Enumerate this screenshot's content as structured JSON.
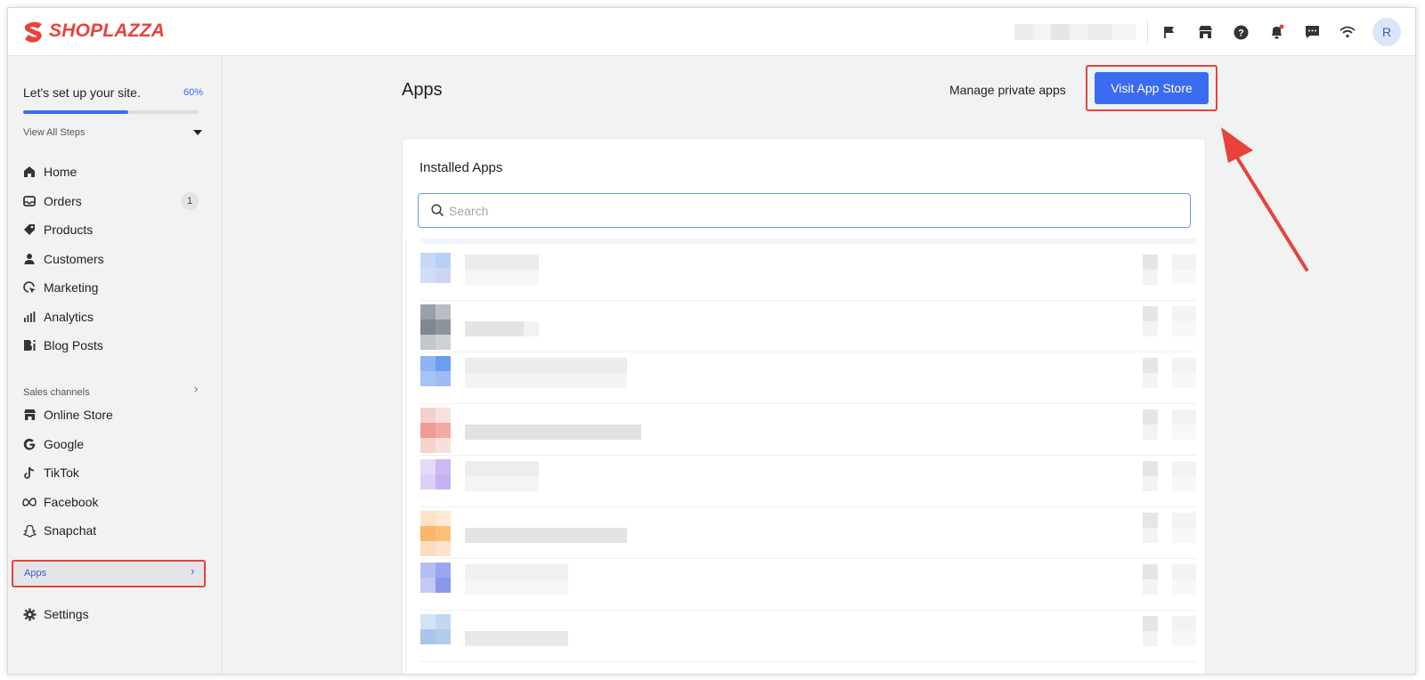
{
  "brand": {
    "name": "SHOPLAZZA",
    "color": "#e8423b"
  },
  "topbar": {
    "icons": [
      "flag-icon",
      "store-icon",
      "help-icon",
      "bell-icon",
      "message-icon",
      "wifi-icon"
    ],
    "avatar_initial": "R"
  },
  "setup": {
    "title": "Let's set up your site.",
    "percent_label": "60%",
    "progress": 0.6,
    "view_steps": "View All Steps"
  },
  "sidebar": {
    "items": [
      {
        "label": "Home",
        "icon": "home-icon"
      },
      {
        "label": "Orders",
        "icon": "inbox-icon",
        "badge": "1"
      },
      {
        "label": "Products",
        "icon": "tag-icon"
      },
      {
        "label": "Customers",
        "icon": "person-icon"
      },
      {
        "label": "Marketing",
        "icon": "cursor-icon"
      },
      {
        "label": "Analytics",
        "icon": "bar-chart-icon"
      },
      {
        "label": "Blog Posts",
        "icon": "blog-icon"
      }
    ],
    "sales_channels_label": "Sales channels",
    "channels": [
      {
        "label": "Online Store",
        "icon": "store-icon"
      },
      {
        "label": "Google",
        "icon": "google-icon"
      },
      {
        "label": "TikTok",
        "icon": "tiktok-icon"
      },
      {
        "label": "Facebook",
        "icon": "meta-icon"
      },
      {
        "label": "Snapchat",
        "icon": "snapchat-icon"
      }
    ],
    "apps_label": "Apps",
    "settings_label": "Settings"
  },
  "main": {
    "title": "Apps",
    "manage_link": "Manage private apps",
    "cta_label": "Visit App Store",
    "card_title": "Installed Apps",
    "search_placeholder": "Search"
  },
  "colors": {
    "accent": "#3b6bf0",
    "highlight": "#e8423b"
  }
}
